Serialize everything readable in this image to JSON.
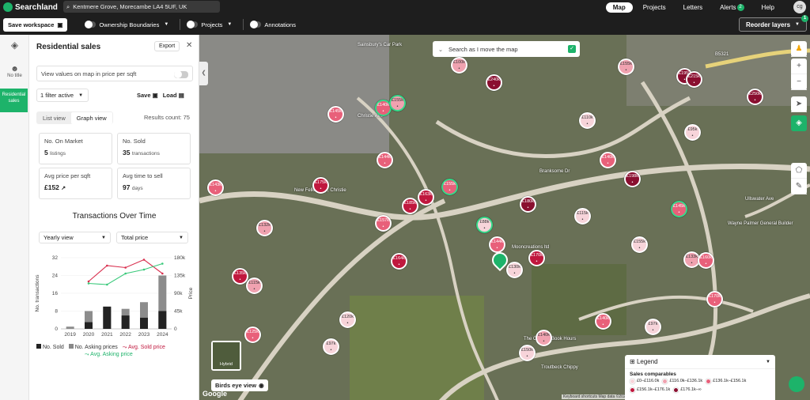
{
  "app": {
    "name": "Searchland"
  },
  "search": {
    "value": "Kentmere Grove, Morecambe LA4 5UF, UK"
  },
  "nav": {
    "map": "Map",
    "projects": "Projects",
    "letters": "Letters",
    "alerts": "Alerts",
    "alerts_count": "2",
    "help": "Help",
    "avatar": "cg"
  },
  "toolbar": {
    "save_workspace": "Save workspace",
    "ownership": "Ownership Boundaries",
    "projects": "Projects",
    "annotations": "Annotations",
    "reorder": "Reorder layers",
    "reorder_count": "1"
  },
  "rail": {
    "untitled": "No title",
    "residential": "Residential sales"
  },
  "panel": {
    "title": "Residential sales",
    "export": "Export",
    "ppsf_label": "View values on map in price per sqft",
    "filter": "1 filter active",
    "save": "Save",
    "load": "Load",
    "tabs": [
      "List view",
      "Graph view"
    ],
    "results": "Results count: 75",
    "stats": [
      {
        "label": "No. On Market",
        "value": "5",
        "unit": "listings"
      },
      {
        "label": "No. Sold",
        "value": "35",
        "unit": "transactions"
      },
      {
        "label": "Avg price per sqft",
        "value": "£152",
        "unit": ""
      },
      {
        "label": "Avg time to sell",
        "value": "97",
        "unit": "days"
      }
    ],
    "chart_heading": "Transactions Over Time",
    "dd_period": "Yearly view",
    "dd_metric": "Total price"
  },
  "chart_data": {
    "type": "bar",
    "categories": [
      "2019",
      "2020",
      "2021",
      "2022",
      "2023",
      "2024"
    ],
    "series": [
      {
        "name": "No. Sold",
        "type": "bar",
        "values": [
          0,
          3,
          10,
          6,
          5,
          8
        ]
      },
      {
        "name": "No. Asking prices",
        "type": "bar",
        "values": [
          1,
          8,
          10,
          9,
          12,
          24
        ]
      },
      {
        "name": "Avg. Sold price",
        "type": "line",
        "values": [
          null,
          120,
          160,
          155,
          175,
          140
        ]
      },
      {
        "name": "Avg. Asking price",
        "type": "line",
        "values": [
          null,
          115,
          112,
          140,
          150,
          165
        ]
      }
    ],
    "ylabel": "No. transactions",
    "y2label": "Price",
    "yticks": [
      "0",
      "8",
      "16",
      "24",
      "32"
    ],
    "y2ticks": [
      "0",
      "45k",
      "90k",
      "135k",
      "180k"
    ],
    "ylim": [
      0,
      32
    ],
    "y2lim": [
      0,
      180
    ],
    "legend_position": "bottom"
  },
  "map": {
    "search_toggle": "Search as I move the map",
    "hybrid": "Hybrid",
    "birds_eye": "Birds eye view",
    "google": "Google",
    "attribution": "Keyboard shortcuts   Map data ©2025   Report a map error",
    "legend_title": "Legend",
    "legend_sub": "Sales comparables",
    "legend_items": [
      {
        "label": "£0–£116.0k",
        "color": "#f7d4da"
      },
      {
        "label": "£116.0k–£136.1k",
        "color": "#f0a2b0"
      },
      {
        "label": "£136.1k–£156.1k",
        "color": "#e8607a"
      },
      {
        "label": "£156.1k–£176.1k",
        "color": "#c0183e"
      },
      {
        "label": "£176.1k–∞",
        "color": "#8a0f30"
      }
    ],
    "place_labels": [
      "Sainsbury's Car Park",
      "New Fellowship, Christie",
      "Mooncreations ltd",
      "Wayne Palmer General Builder",
      "Troutbeck Chippy",
      "The Counter Book Hours",
      "B5321",
      "Ullswater Ave",
      "Christie Ave",
      "Branksome Dr"
    ],
    "pins": [
      {
        "label": "£145k"
      },
      {
        "label": "£140k"
      },
      {
        "label": "£155k"
      },
      {
        "label": "£100k"
      },
      {
        "label": "£240k"
      },
      {
        "label": "£155k"
      },
      {
        "label": "£195k"
      },
      {
        "label": "£215k"
      },
      {
        "label": "£250k"
      },
      {
        "label": "£110k"
      },
      {
        "label": "£95k"
      },
      {
        "label": "£144k"
      },
      {
        "label": "£140k"
      },
      {
        "label": "£175k"
      },
      {
        "label": "£155k"
      },
      {
        "label": "£163k"
      },
      {
        "label": "£185k"
      },
      {
        "label": "£143k"
      },
      {
        "label": "£198k"
      },
      {
        "label": "£180k"
      },
      {
        "label": "£115k"
      },
      {
        "label": "£145k"
      },
      {
        "label": "£132k"
      },
      {
        "label": "£157k"
      },
      {
        "label": "£88k"
      },
      {
        "label": "£144k"
      },
      {
        "label": "£164k"
      },
      {
        "label": "£170k"
      },
      {
        "label": "£130k"
      },
      {
        "label": "£155k"
      },
      {
        "label": "£133k"
      },
      {
        "label": "£160k"
      },
      {
        "label": "£135k"
      },
      {
        "label": "£115k"
      },
      {
        "label": "£170k"
      },
      {
        "label": "£120k"
      },
      {
        "label": "£140k"
      },
      {
        "label": "£97k"
      },
      {
        "label": "£125k"
      },
      {
        "label": "£97k"
      },
      {
        "label": "£140k"
      },
      {
        "label": "£150k"
      }
    ]
  }
}
